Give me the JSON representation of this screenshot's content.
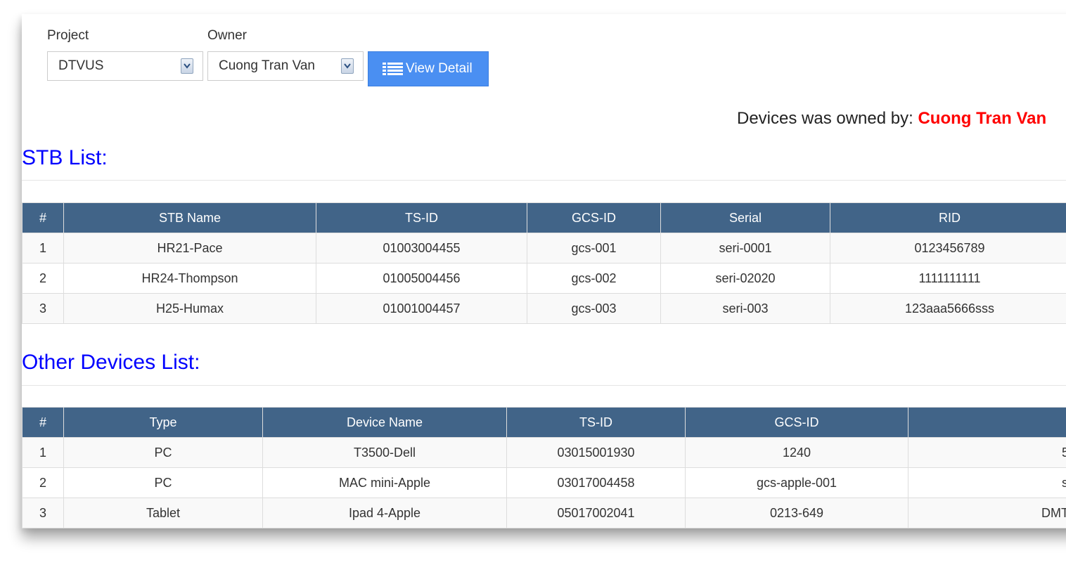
{
  "filters": {
    "project_label": "Project",
    "project_value": "DTVUS",
    "owner_label": "Owner",
    "owner_value": "Cuong Tran Van",
    "view_button": "View Detail"
  },
  "owned_by": {
    "prefix": "Devices was owned by:",
    "name": "Cuong Tran Van"
  },
  "stb": {
    "title": "STB List:",
    "columns": [
      "#",
      "STB Name",
      "TS-ID",
      "GCS-ID",
      "Serial",
      "RID"
    ],
    "rows": [
      [
        "1",
        "HR21-Pace",
        "01003004455",
        "gcs-001",
        "seri-0001",
        "0123456789"
      ],
      [
        "2",
        "HR24-Thompson",
        "01005004456",
        "gcs-002",
        "seri-02020",
        "1111111111"
      ],
      [
        "3",
        "H25-Humax",
        "01001004457",
        "gcs-003",
        "seri-003",
        "123aaa5666sss"
      ]
    ]
  },
  "other": {
    "title": "Other Devices List:",
    "columns": [
      "#",
      "Type",
      "Device Name",
      "TS-ID",
      "GCS-ID",
      ""
    ],
    "rows": [
      [
        "1",
        "PC",
        "T3500-Dell",
        "03015001930",
        "1240",
        "5"
      ],
      [
        "2",
        "PC",
        "MAC mini-Apple",
        "03017004458",
        "gcs-apple-001",
        "s"
      ],
      [
        "3",
        "Tablet",
        "Ipad 4-Apple",
        "05017002041",
        "0213-649",
        "DMT"
      ]
    ]
  },
  "colors": {
    "table_header": "#416488",
    "button": "#4a8ff2",
    "section_title": "#0000ff",
    "owner_highlight": "#ff0000"
  },
  "icons": {
    "view_button": "list-icon",
    "select_arrow": "chevron-down-icon"
  }
}
